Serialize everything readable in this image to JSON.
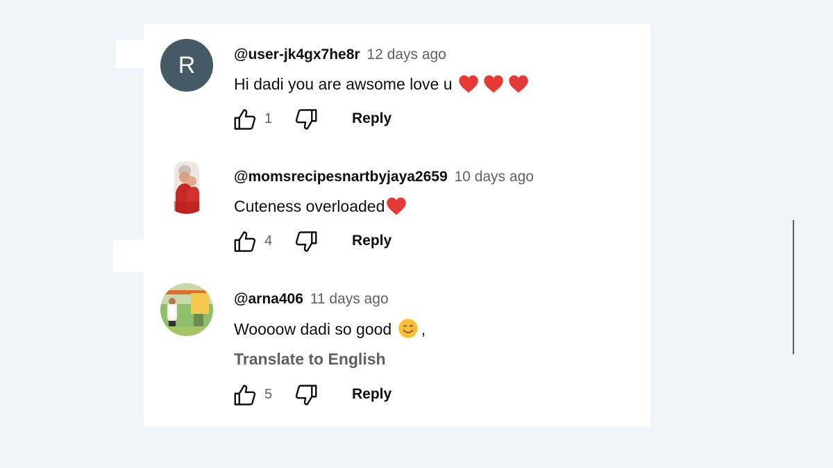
{
  "comments": [
    {
      "author": "@user-jk4gx7he8r",
      "time": "12 days ago",
      "text": "Hi dadi you are awsome love u",
      "emojis": [
        "❤️",
        "❤️",
        "❤️"
      ],
      "avatar_letter": "R",
      "avatar_color": "#455a64",
      "likes": "1",
      "reply_label": "Reply"
    },
    {
      "author": "@momsrecipesnartbyjaya2659",
      "time": "10 days ago",
      "text": "Cuteness overloaded",
      "emojis": [
        "❤️"
      ],
      "likes": "4",
      "reply_label": "Reply"
    },
    {
      "author": "@arna406",
      "time": "11 days ago",
      "text": "Woooow dadi so good",
      "emojis": [
        "😊"
      ],
      "trailing_text": ",",
      "translate_label": "Translate to English",
      "likes": "5",
      "reply_label": "Reply"
    }
  ],
  "colors": {
    "page_background": "#f2f4f9",
    "card_background": "#ffffff",
    "author_text": "#0f0f0f",
    "secondary_text": "#606060",
    "heart": "#e53935",
    "avatar_r": "#455a64"
  },
  "icons": {
    "like": "thumb-up-outline-icon",
    "dislike": "thumb-down-outline-icon",
    "heart": "red-heart-emoji-icon",
    "smile": "smiling-face-emoji-icon"
  }
}
